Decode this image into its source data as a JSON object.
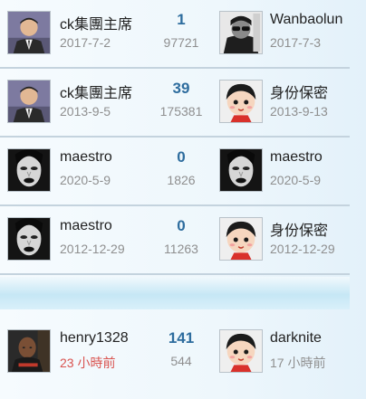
{
  "rows": [
    {
      "left": {
        "avatar": "man-suit-avatar",
        "name": "ck集團主席",
        "date": "2017-7-2"
      },
      "replies": "1",
      "views": "97721",
      "right": {
        "avatar": "sunglasses-man-avatar",
        "name": "Wanbaolun",
        "date": "2017-7-3"
      }
    },
    {
      "left": {
        "avatar": "man-suit-avatar",
        "name": "ck集團主席",
        "date": "2013-9-5"
      },
      "replies": "39",
      "views": "175381",
      "right": {
        "avatar": "cartoon-girl-avatar",
        "name": "身份保密",
        "date": "2013-9-13"
      }
    },
    {
      "left": {
        "avatar": "face-bw-avatar",
        "name": "maestro",
        "date": "2020-5-9"
      },
      "replies": "0",
      "views": "1826",
      "right": {
        "avatar": "face-bw-avatar",
        "name": "maestro",
        "date": "2020-5-9"
      }
    },
    {
      "left": {
        "avatar": "face-bw-avatar",
        "name": "maestro",
        "date": "2012-12-29"
      },
      "replies": "0",
      "views": "11263",
      "right": {
        "avatar": "cartoon-girl-avatar",
        "name": "身份保密",
        "date": "2012-12-29"
      }
    },
    {
      "left": {
        "avatar": "bald-man-avatar",
        "name": "henry1328",
        "date": "23 小時前"
      },
      "replies": "141",
      "views": "544",
      "right": {
        "avatar": "cartoon-girl-avatar",
        "name": "darknite",
        "date": "17 小時前"
      }
    }
  ],
  "colors": {
    "reply_count": "#2e6d9e",
    "recent_date": "#d9534f",
    "meta_gray": "#8f8f8f",
    "divider": "#c4d3de"
  }
}
